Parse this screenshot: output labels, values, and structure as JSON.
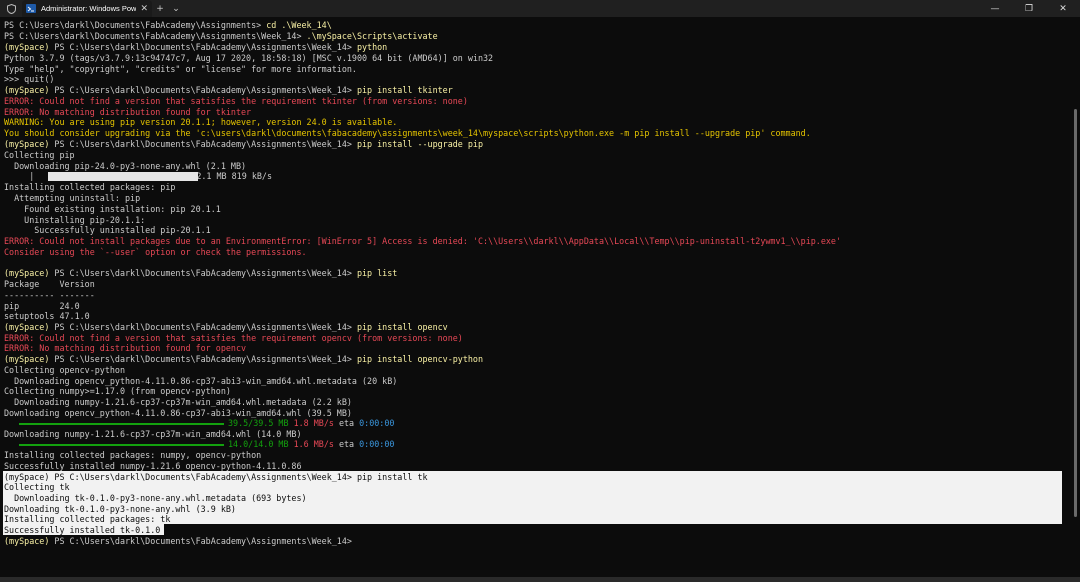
{
  "window": {
    "tab_title": "Administrator: Windows Pow",
    "new_tab": "+",
    "dropdown": "⌄",
    "close_tab": "✕",
    "minimize": "—",
    "maximize": "❐",
    "close": "✕"
  },
  "progress": {
    "pip_fraction": 1.0,
    "opencv_fraction": 1.0,
    "numpy_fraction": 1.0
  },
  "colors": {
    "prompt_env": "#f9f1a5",
    "error": "#e74856",
    "warning": "#e5c400",
    "progress": "#13a10e",
    "eta": "#3a96dd"
  },
  "terminal": {
    "l00": {
      "text": "PS C:\\Users\\darkl\\Documents\\FabAcademy\\Assignments> ",
      "cmd": "cd .\\Week_14\\"
    },
    "l01": {
      "text": "PS C:\\Users\\darkl\\Documents\\FabAcademy\\Assignments\\Week_14> ",
      "cmd": ".\\mySpace\\Scripts\\activate"
    },
    "l02": {
      "env": "(mySpace) ",
      "text": "PS C:\\Users\\darkl\\Documents\\FabAcademy\\Assignments\\Week_14> ",
      "cmd": "python"
    },
    "l03": "Python 3.7.9 (tags/v3.7.9:13c94747c7, Aug 17 2020, 18:58:18) [MSC v.1900 64 bit (AMD64)] on win32",
    "l04": "Type \"help\", \"copyright\", \"credits\" or \"license\" for more information.",
    "l05": ">>> quit()",
    "l06": {
      "env": "(mySpace) ",
      "text": "PS C:\\Users\\darkl\\Documents\\FabAcademy\\Assignments\\Week_14> ",
      "cmd": "pip install tkinter"
    },
    "l07": "ERROR: Could not find a version that satisfies the requirement tkinter (from versions: none)",
    "l08": "ERROR: No matching distribution found for tkinter",
    "l09": "WARNING: You are using pip version 20.1.1; however, version 24.0 is available.",
    "l10": "You should consider upgrading via the 'c:\\users\\darkl\\documents\\fabacademy\\assignments\\week_14\\myspace\\scripts\\python.exe -m pip install --upgrade pip' command.",
    "l11": {
      "env": "(mySpace) ",
      "text": "PS C:\\Users\\darkl\\Documents\\FabAcademy\\Assignments\\Week_14> ",
      "cmd": "pip install --upgrade pip"
    },
    "l12": "Collecting pip",
    "l13": "  Downloading pip-24.0-py3-none-any.whl (2.1 MB)",
    "l14": {
      "pre": "     |",
      "post": "| 2.1 MB 819 kB/s"
    },
    "l15": "Installing collected packages: pip",
    "l16": "  Attempting uninstall: pip",
    "l17": "    Found existing installation: pip 20.1.1",
    "l18": "    Uninstalling pip-20.1.1:",
    "l19": "      Successfully uninstalled pip-20.1.1",
    "l20": "ERROR: Could not install packages due to an EnvironmentError: [WinError 5] Access is denied: 'C:\\\\Users\\\\darkl\\\\AppData\\\\Local\\\\Temp\\\\pip-uninstall-t2ywmv1_\\\\pip.exe'",
    "l21": "Consider using the `--user` option or check the permissions.",
    "l23": {
      "env": "(mySpace) ",
      "text": "PS C:\\Users\\darkl\\Documents\\FabAcademy\\Assignments\\Week_14> ",
      "cmd": "pip list"
    },
    "l24": "Package    Version",
    "l25": "---------- -------",
    "l26": "pip        24.0",
    "l27": "setuptools 47.1.0",
    "l28": {
      "env": "(mySpace) ",
      "text": "PS C:\\Users\\darkl\\Documents\\FabAcademy\\Assignments\\Week_14> ",
      "cmd": "pip install opencv"
    },
    "l29": "ERROR: Could not find a version that satisfies the requirement opencv (from versions: none)",
    "l30": "ERROR: No matching distribution found for opencv",
    "l31": {
      "env": "(mySpace) ",
      "text": "PS C:\\Users\\darkl\\Documents\\FabAcademy\\Assignments\\Week_14> ",
      "cmd": "pip install opencv-python"
    },
    "l32": "Collecting opencv-python",
    "l33": "  Downloading opencv_python-4.11.0.86-cp37-abi3-win_amd64.whl.metadata (20 kB)",
    "l34": "Collecting numpy>=1.17.0 (from opencv-python)",
    "l35": "  Downloading numpy-1.21.6-cp37-cp37m-win_amd64.whl.metadata (2.2 kB)",
    "l36": "Downloading opencv_python-4.11.0.86-cp37-abi3-win_amd64.whl (39.5 MB)",
    "l37": {
      "size": "39.5/39.5 MB",
      "rate": "1.8 MB/s",
      "eta_label": "eta",
      "eta": "0:00:00"
    },
    "l38": "Downloading numpy-1.21.6-cp37-cp37m-win_amd64.whl (14.0 MB)",
    "l39": {
      "size": "14.0/14.0 MB",
      "rate": "1.6 MB/s",
      "eta_label": "eta",
      "eta": "0:00:00"
    },
    "l40": "Installing collected packages: numpy, opencv-python",
    "l41": "Successfully installed numpy-1.21.6 opencv-python-4.11.0.86",
    "l42": {
      "env": "(mySpace) ",
      "text": "PS C:\\Users\\darkl\\Documents\\FabAcademy\\Assignments\\Week_14> ",
      "cmd": "pip install tk"
    },
    "l43": "Collecting tk",
    "l44": "  Downloading tk-0.1.0-py3-none-any.whl.metadata (693 bytes)",
    "l45": "Downloading tk-0.1.0-py3-none-any.whl (3.9 kB)",
    "l46": "Installing collected packages: tk",
    "l47": "Successfully installed tk-0.1.0",
    "l48": {
      "env": "(mySpace) ",
      "text": "PS C:\\Users\\darkl\\Documents\\FabAcademy\\Assignments\\Week_14>"
    }
  }
}
